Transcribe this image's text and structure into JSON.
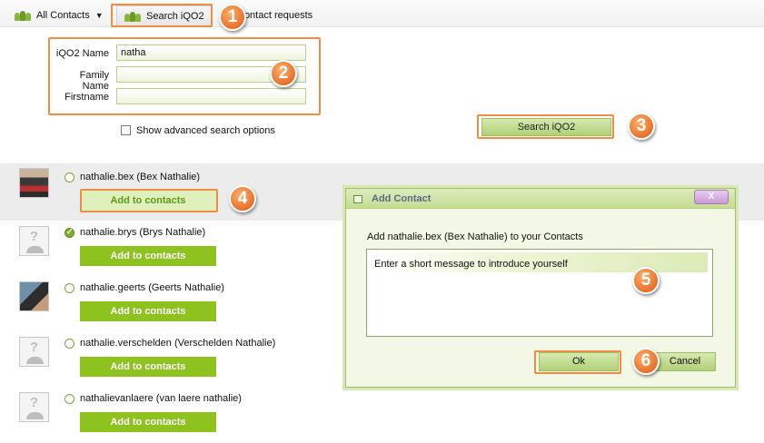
{
  "tabs": {
    "all_contacts": "All Contacts",
    "search": "Search iQO2",
    "requests": "Contact requests"
  },
  "search_form": {
    "iqo2_name_label": "iQO2 Name",
    "iqo2_name_value": "natha",
    "family_name_label": "Family Name",
    "family_name_value": "",
    "firstname_label": "Firstname",
    "firstname_value": "",
    "advanced_label": "Show advanced search options",
    "search_button": "Search iQO2"
  },
  "results": [
    {
      "name": "nathalie.bex (Bex Nathalie)",
      "button": "Add to contacts",
      "selected": false
    },
    {
      "name": "nathalie.brys (Brys Nathalie)",
      "button": "Add to contacts",
      "selected": true
    },
    {
      "name": "nathalie.geerts (Geerts Nathalie)",
      "button": "Add to contacts",
      "selected": false
    },
    {
      "name": "nathalie.verschelden (Verschelden Nathalie)",
      "button": "Add to contacts",
      "selected": false
    },
    {
      "name": "nathalievanlaere (van laere nathalie)",
      "button": "Add to contacts",
      "selected": false
    }
  ],
  "dialog": {
    "title": "Add Contact",
    "close": "X",
    "message": "Add nathalie.bex (Bex Nathalie) to your Contacts",
    "textarea_text": "Enter a short message to introduce yourself",
    "ok": "Ok",
    "cancel": "Cancel"
  },
  "callouts": [
    "1",
    "2",
    "3",
    "4",
    "5",
    "6"
  ],
  "colors": {
    "accent_green": "#8dc21f",
    "callout_orange": "#ef8d45"
  },
  "icons": {
    "tab_all": "contacts-group-icon",
    "tab_search": "add-user-icon",
    "dropdown": "chevron-down-icon"
  }
}
